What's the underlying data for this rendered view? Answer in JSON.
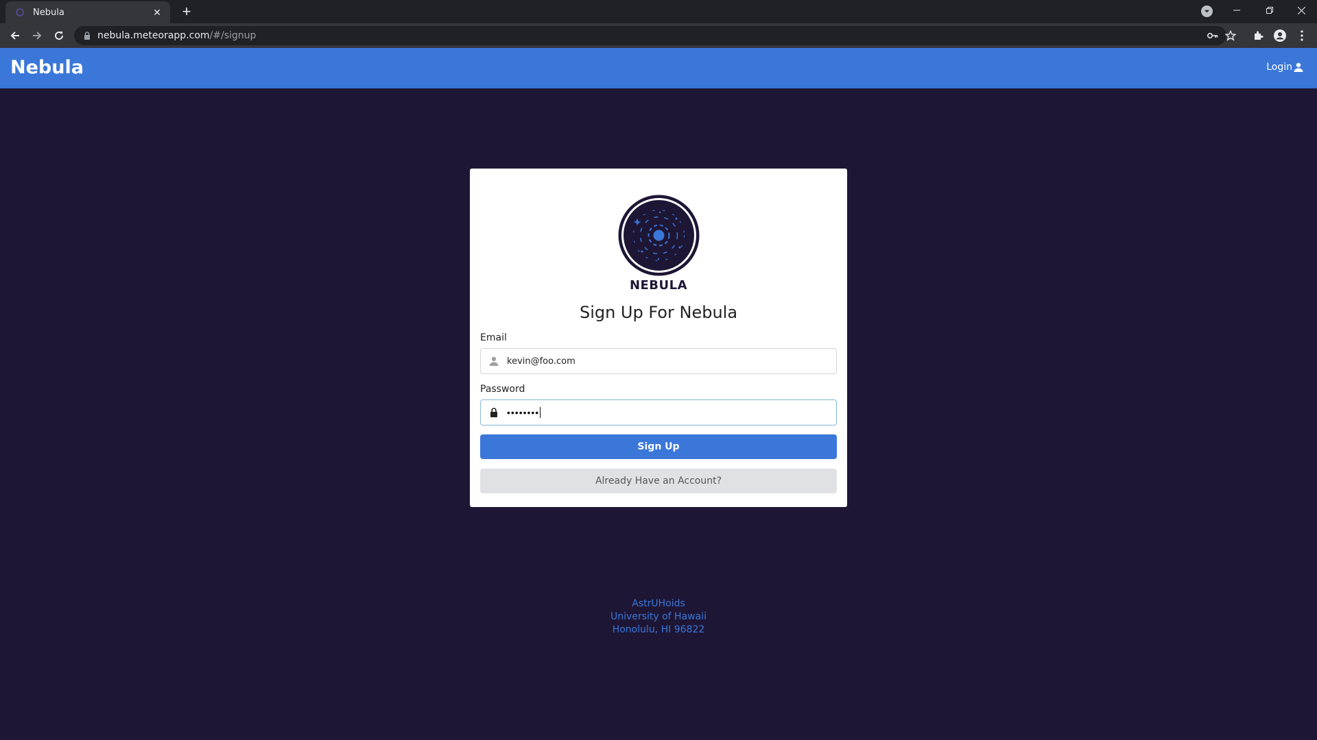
{
  "browser": {
    "tab_title": "Nebula",
    "url_host": "nebula.meteorapp.com",
    "url_path": "/#/signup"
  },
  "navbar": {
    "brand": "Nebula",
    "login_label": "Login"
  },
  "signup": {
    "logo_text": "NEBULA",
    "title": "Sign Up For Nebula",
    "email_label": "Email",
    "email_value": "kevin@foo.com",
    "password_label": "Password",
    "password_masked": "••••••••",
    "submit_label": "Sign Up",
    "secondary_label": "Already Have an Account?"
  },
  "footer": {
    "line1": "AstrUHoids",
    "line2": "University of Hawaii",
    "line3": "Honolulu, HI 96822"
  },
  "colors": {
    "page_bg": "#1e1635",
    "navbar_bg": "#3a77d9",
    "accent": "#3a77d9"
  }
}
